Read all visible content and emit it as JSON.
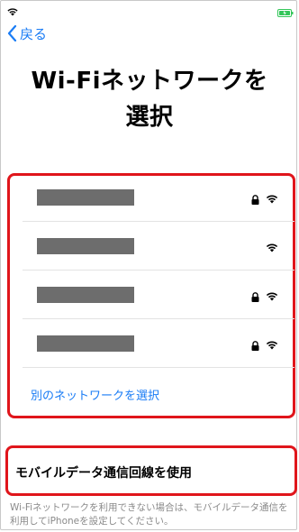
{
  "status_bar": {
    "wifi_icon": "wifi-icon",
    "battery_icon": "battery-charging-icon",
    "battery_color": "#33c659"
  },
  "nav": {
    "back_label": "戻る",
    "back_icon": "chevron-left-icon",
    "accent": "#1a7cf5"
  },
  "title": {
    "line1": "Wi-Fiネットワークを",
    "line2": "選択"
  },
  "networks": [
    {
      "name": "",
      "locked": true
    },
    {
      "name": "",
      "locked": false
    },
    {
      "name": "",
      "locked": true
    },
    {
      "name": "",
      "locked": true
    }
  ],
  "other_network_label": "別のネットワークを選択",
  "mobile_data_label": "モバイルデータ通信回線を使用",
  "footnote": "Wi-Fiネットワークを利用できない場合は、モバイルデータ通信を利用してiPhoneを設定してください。",
  "highlight_color": "#e0151b"
}
